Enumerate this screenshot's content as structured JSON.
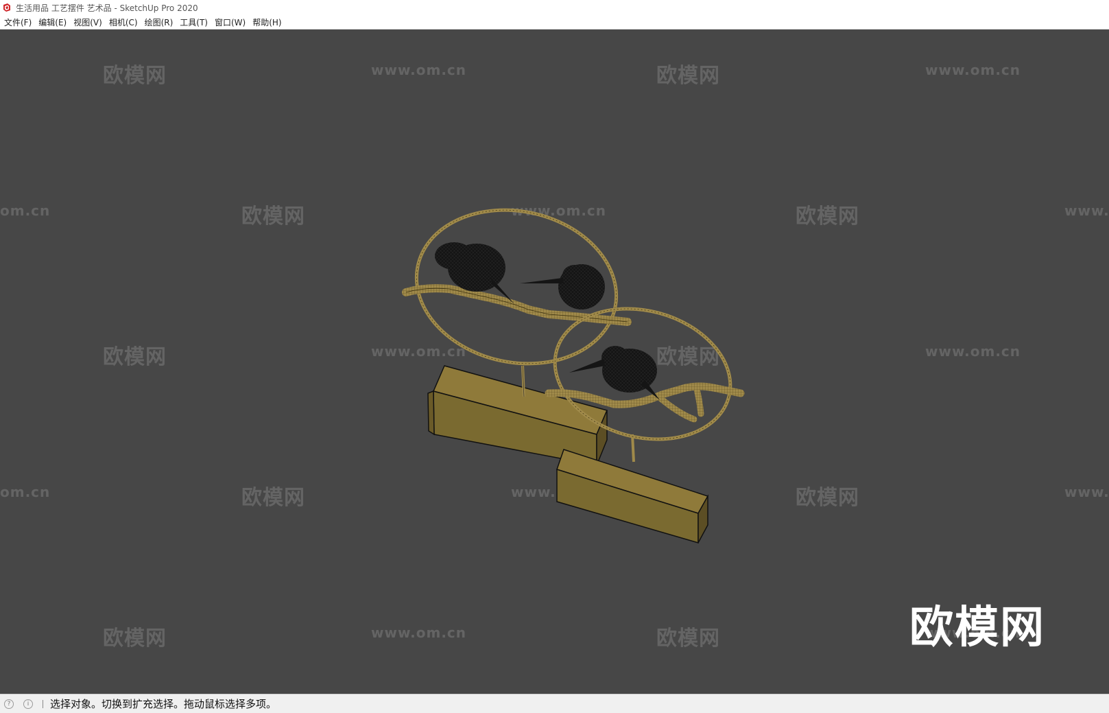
{
  "window": {
    "title": "生活用品 工艺摆件 艺术品 - SketchUp Pro 2020",
    "app_icon": "sketchup-logo-icon"
  },
  "menubar": {
    "items": [
      {
        "label": "文件(F)"
      },
      {
        "label": "编辑(E)"
      },
      {
        "label": "视图(V)"
      },
      {
        "label": "相机(C)"
      },
      {
        "label": "绘图(R)"
      },
      {
        "label": "工具(T)"
      },
      {
        "label": "窗口(W)"
      },
      {
        "label": "帮助(H)"
      }
    ]
  },
  "viewport": {
    "background": "#474747",
    "watermark_cn": "欧模网",
    "watermark_url": "www.om.cn",
    "watermark_url_partial_left": "om.cn",
    "watermark_url_partial_right": "www.",
    "logo_text": "欧模网"
  },
  "statusbar": {
    "icons": [
      "geolocation-icon",
      "info-icon"
    ],
    "text": "选择对象。切换到扩充选择。拖动鼠标选择多项。"
  },
  "colors": {
    "wood": "#a08a4a",
    "base": "#7a6a30",
    "bird": "#151515"
  }
}
